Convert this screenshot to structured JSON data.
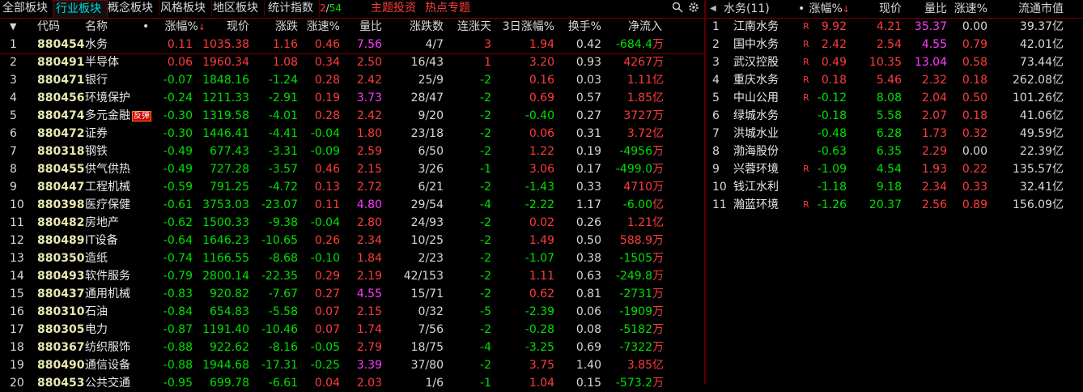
{
  "toolbar": {
    "tabs": [
      "全部板块",
      "行业板块",
      "概念板块",
      "风格板块",
      "地区板块",
      "统计指数"
    ],
    "active_tab": 1,
    "page_current": "2",
    "page_sep": "/",
    "page_total": "54",
    "topic_links": [
      "主题投资",
      "热点专题"
    ],
    "search_icon": "search-icon",
    "settings_icon": "gear-icon"
  },
  "table": {
    "headers": {
      "code": "代码",
      "name": "名称",
      "dot": "•",
      "change_pct": "涨幅%",
      "price": "现价",
      "change": "涨跌",
      "speed": "涨速%",
      "vol_ratio": "量比",
      "updown": "涨跌数",
      "streak": "连涨天",
      "chg3d": "3日涨幅%",
      "turnover": "换手%",
      "netflow": "净流入"
    },
    "sort_arrow": "↓",
    "rows": [
      {
        "idx": "1",
        "code": "880454",
        "name": "水务",
        "chg": "0.11",
        "price": "1035.38",
        "diff": "1.16",
        "speed": "0.46",
        "vr": "7.56",
        "ud": "4/7",
        "streak": "3",
        "chg3d": "1.94",
        "turn": "0.42",
        "flow": "-684.4",
        "unit": "万",
        "cchg": "red",
        "cspeed": "red",
        "cvr": "purple",
        "cstreak": "red",
        "c3d": "red",
        "badge": ""
      },
      {
        "idx": "2",
        "code": "880491",
        "name": "半导体",
        "chg": "0.06",
        "price": "1960.34",
        "diff": "1.08",
        "speed": "0.34",
        "vr": "2.50",
        "ud": "16/43",
        "streak": "1",
        "chg3d": "3.20",
        "turn": "0.93",
        "flow": "4267",
        "unit": "万",
        "cchg": "red",
        "cspeed": "red",
        "cvr": "red",
        "cstreak": "red",
        "c3d": "red",
        "badge": ""
      },
      {
        "idx": "3",
        "code": "880471",
        "name": "银行",
        "chg": "-0.07",
        "price": "1848.16",
        "diff": "-1.24",
        "speed": "0.28",
        "vr": "2.42",
        "ud": "25/9",
        "streak": "-2",
        "chg3d": "0.16",
        "turn": "0.03",
        "flow": "1.11",
        "unit": "亿",
        "cchg": "green",
        "cspeed": "red",
        "cvr": "red",
        "cstreak": "green",
        "c3d": "red",
        "badge": ""
      },
      {
        "idx": "4",
        "code": "880456",
        "name": "环境保护",
        "chg": "-0.24",
        "price": "1211.33",
        "diff": "-2.91",
        "speed": "0.19",
        "vr": "3.73",
        "ud": "28/47",
        "streak": "-2",
        "chg3d": "0.69",
        "turn": "0.57",
        "flow": "1.85",
        "unit": "亿",
        "cchg": "green",
        "cspeed": "red",
        "cvr": "purple",
        "cstreak": "green",
        "c3d": "red",
        "badge": ""
      },
      {
        "idx": "5",
        "code": "880474",
        "name": "多元金融",
        "chg": "-0.30",
        "price": "1319.58",
        "diff": "-4.01",
        "speed": "0.28",
        "vr": "2.42",
        "ud": "9/20",
        "streak": "-2",
        "chg3d": "-0.40",
        "turn": "0.27",
        "flow": "3727",
        "unit": "万",
        "cchg": "green",
        "cspeed": "red",
        "cvr": "red",
        "cstreak": "green",
        "c3d": "green",
        "badge": "反弹"
      },
      {
        "idx": "6",
        "code": "880472",
        "name": "证券",
        "chg": "-0.30",
        "price": "1446.41",
        "diff": "-4.41",
        "speed": "-0.04",
        "vr": "1.80",
        "ud": "23/18",
        "streak": "-2",
        "chg3d": "0.06",
        "turn": "0.31",
        "flow": "3.72",
        "unit": "亿",
        "cchg": "green",
        "cspeed": "green",
        "cvr": "red",
        "cstreak": "green",
        "c3d": "red",
        "badge": ""
      },
      {
        "idx": "7",
        "code": "880318",
        "name": "钢铁",
        "chg": "-0.49",
        "price": "677.43",
        "diff": "-3.31",
        "speed": "-0.09",
        "vr": "2.59",
        "ud": "6/50",
        "streak": "-2",
        "chg3d": "1.22",
        "turn": "0.19",
        "flow": "-4956",
        "unit": "万",
        "cchg": "green",
        "cspeed": "green",
        "cvr": "red",
        "cstreak": "green",
        "c3d": "red",
        "badge": ""
      },
      {
        "idx": "8",
        "code": "880455",
        "name": "供气供热",
        "chg": "-0.49",
        "price": "727.28",
        "diff": "-3.57",
        "speed": "0.46",
        "vr": "2.15",
        "ud": "3/26",
        "streak": "-1",
        "chg3d": "3.06",
        "turn": "0.17",
        "flow": "-499.0",
        "unit": "万",
        "cchg": "green",
        "cspeed": "red",
        "cvr": "red",
        "cstreak": "green",
        "c3d": "red",
        "badge": ""
      },
      {
        "idx": "9",
        "code": "880447",
        "name": "工程机械",
        "chg": "-0.59",
        "price": "791.25",
        "diff": "-4.72",
        "speed": "0.13",
        "vr": "2.72",
        "ud": "6/21",
        "streak": "-2",
        "chg3d": "-1.43",
        "turn": "0.33",
        "flow": "4710",
        "unit": "万",
        "cchg": "green",
        "cspeed": "red",
        "cvr": "red",
        "cstreak": "green",
        "c3d": "green",
        "badge": ""
      },
      {
        "idx": "10",
        "code": "880398",
        "name": "医疗保健",
        "chg": "-0.61",
        "price": "3753.03",
        "diff": "-23.07",
        "speed": "0.11",
        "vr": "4.80",
        "ud": "29/54",
        "streak": "-4",
        "chg3d": "-2.22",
        "turn": "1.17",
        "flow": "-6.00",
        "unit": "亿",
        "cchg": "green",
        "cspeed": "red",
        "cvr": "purple",
        "cstreak": "green",
        "c3d": "green",
        "badge": ""
      },
      {
        "idx": "11",
        "code": "880482",
        "name": "房地产",
        "chg": "-0.62",
        "price": "1500.33",
        "diff": "-9.38",
        "speed": "-0.04",
        "vr": "2.80",
        "ud": "24/93",
        "streak": "-2",
        "chg3d": "0.02",
        "turn": "0.26",
        "flow": "1.21",
        "unit": "亿",
        "cchg": "green",
        "cspeed": "green",
        "cvr": "red",
        "cstreak": "green",
        "c3d": "red",
        "badge": ""
      },
      {
        "idx": "12",
        "code": "880489",
        "name": "IT设备",
        "chg": "-0.64",
        "price": "1646.23",
        "diff": "-10.65",
        "speed": "0.26",
        "vr": "2.34",
        "ud": "10/25",
        "streak": "-2",
        "chg3d": "1.49",
        "turn": "0.50",
        "flow": "588.9",
        "unit": "万",
        "cchg": "green",
        "cspeed": "red",
        "cvr": "red",
        "cstreak": "green",
        "c3d": "red",
        "badge": ""
      },
      {
        "idx": "13",
        "code": "880350",
        "name": "造纸",
        "chg": "-0.74",
        "price": "1166.55",
        "diff": "-8.68",
        "speed": "-0.10",
        "vr": "1.84",
        "ud": "2/23",
        "streak": "-2",
        "chg3d": "-1.07",
        "turn": "0.38",
        "flow": "-1505",
        "unit": "万",
        "cchg": "green",
        "cspeed": "green",
        "cvr": "red",
        "cstreak": "green",
        "c3d": "green",
        "badge": ""
      },
      {
        "idx": "14",
        "code": "880493",
        "name": "软件服务",
        "chg": "-0.79",
        "price": "2800.14",
        "diff": "-22.35",
        "speed": "0.29",
        "vr": "2.19",
        "ud": "42/153",
        "streak": "-2",
        "chg3d": "1.11",
        "turn": "0.63",
        "flow": "-249.8",
        "unit": "万",
        "cchg": "green",
        "cspeed": "red",
        "cvr": "red",
        "cstreak": "green",
        "c3d": "red",
        "badge": ""
      },
      {
        "idx": "15",
        "code": "880437",
        "name": "通用机械",
        "chg": "-0.83",
        "price": "920.82",
        "diff": "-7.67",
        "speed": "0.27",
        "vr": "4.55",
        "ud": "15/71",
        "streak": "-2",
        "chg3d": "0.62",
        "turn": "0.81",
        "flow": "-2731",
        "unit": "万",
        "cchg": "green",
        "cspeed": "red",
        "cvr": "purple",
        "cstreak": "green",
        "c3d": "red",
        "badge": ""
      },
      {
        "idx": "16",
        "code": "880310",
        "name": "石油",
        "chg": "-0.84",
        "price": "654.83",
        "diff": "-5.58",
        "speed": "0.07",
        "vr": "2.15",
        "ud": "0/32",
        "streak": "-5",
        "chg3d": "-2.39",
        "turn": "0.06",
        "flow": "-1909",
        "unit": "万",
        "cchg": "green",
        "cspeed": "red",
        "cvr": "red",
        "cstreak": "green",
        "c3d": "green",
        "badge": ""
      },
      {
        "idx": "17",
        "code": "880305",
        "name": "电力",
        "chg": "-0.87",
        "price": "1191.40",
        "diff": "-10.46",
        "speed": "0.07",
        "vr": "1.74",
        "ud": "7/56",
        "streak": "-2",
        "chg3d": "-0.28",
        "turn": "0.08",
        "flow": "-5182",
        "unit": "万",
        "cchg": "green",
        "cspeed": "red",
        "cvr": "red",
        "cstreak": "green",
        "c3d": "green",
        "badge": ""
      },
      {
        "idx": "18",
        "code": "880367",
        "name": "纺织服饰",
        "chg": "-0.88",
        "price": "922.62",
        "diff": "-8.16",
        "speed": "-0.05",
        "vr": "2.79",
        "ud": "18/75",
        "streak": "-4",
        "chg3d": "-3.25",
        "turn": "0.69",
        "flow": "-7322",
        "unit": "万",
        "cchg": "green",
        "cspeed": "green",
        "cvr": "red",
        "cstreak": "green",
        "c3d": "green",
        "badge": ""
      },
      {
        "idx": "19",
        "code": "880490",
        "name": "通信设备",
        "chg": "-0.88",
        "price": "1944.68",
        "diff": "-17.31",
        "speed": "-0.25",
        "vr": "3.39",
        "ud": "37/80",
        "streak": "-2",
        "chg3d": "3.75",
        "turn": "1.40",
        "flow": "3.85",
        "unit": "亿",
        "cchg": "green",
        "cspeed": "green",
        "cvr": "purple",
        "cstreak": "green",
        "c3d": "red",
        "badge": ""
      },
      {
        "idx": "20",
        "code": "880453",
        "name": "公共交通",
        "chg": "-0.95",
        "price": "699.78",
        "diff": "-6.61",
        "speed": "0.04",
        "vr": "2.03",
        "ud": "1/6",
        "streak": "-1",
        "chg3d": "1.04",
        "turn": "0.15",
        "flow": "-573.2",
        "unit": "万",
        "cchg": "green",
        "cspeed": "red",
        "cvr": "red",
        "cstreak": "green",
        "c3d": "red",
        "badge": ""
      }
    ]
  },
  "right_panel": {
    "title": "水务(11)",
    "dot": "•",
    "headers": {
      "chg": "涨幅%",
      "price": "现价",
      "vr": "量比",
      "speed": "涨速%",
      "mcap": "流通市值"
    },
    "sort_arrow": "↓",
    "panel_icon": "panel-toggle-icon",
    "rows": [
      {
        "idx": "1",
        "name": "江南水务",
        "flag": "R",
        "chg": "9.92",
        "price": "4.21",
        "vr": "35.37",
        "speed": "0.00",
        "mcap": "39.37",
        "unit": "亿",
        "cchg": "red",
        "cvr": "purple",
        "cspeed": "white"
      },
      {
        "idx": "2",
        "name": "国中水务",
        "flag": "R",
        "chg": "2.42",
        "price": "2.54",
        "vr": "4.55",
        "speed": "0.79",
        "mcap": "42.01",
        "unit": "亿",
        "cchg": "red",
        "cvr": "purple",
        "cspeed": "red"
      },
      {
        "idx": "3",
        "name": "武汉控股",
        "flag": "R",
        "chg": "0.49",
        "price": "10.35",
        "vr": "13.04",
        "speed": "0.58",
        "mcap": "73.44",
        "unit": "亿",
        "cchg": "red",
        "cvr": "purple",
        "cspeed": "red"
      },
      {
        "idx": "4",
        "name": "重庆水务",
        "flag": "R",
        "chg": "0.18",
        "price": "5.46",
        "vr": "2.32",
        "speed": "0.18",
        "mcap": "262.08",
        "unit": "亿",
        "cchg": "red",
        "cvr": "red",
        "cspeed": "red"
      },
      {
        "idx": "5",
        "name": "中山公用",
        "flag": "R",
        "chg": "-0.12",
        "price": "8.08",
        "vr": "2.04",
        "speed": "0.50",
        "mcap": "101.26",
        "unit": "亿",
        "cchg": "green",
        "cvr": "red",
        "cspeed": "red"
      },
      {
        "idx": "6",
        "name": "绿城水务",
        "flag": "",
        "chg": "-0.18",
        "price": "5.58",
        "vr": "2.07",
        "speed": "0.18",
        "mcap": "41.06",
        "unit": "亿",
        "cchg": "green",
        "cvr": "red",
        "cspeed": "red"
      },
      {
        "idx": "7",
        "name": "洪城水业",
        "flag": "",
        "chg": "-0.48",
        "price": "6.28",
        "vr": "1.73",
        "speed": "0.32",
        "mcap": "49.59",
        "unit": "亿",
        "cchg": "green",
        "cvr": "red",
        "cspeed": "red"
      },
      {
        "idx": "8",
        "name": "渤海股份",
        "flag": "",
        "chg": "-0.63",
        "price": "6.35",
        "vr": "2.29",
        "speed": "0.00",
        "mcap": "22.39",
        "unit": "亿",
        "cchg": "green",
        "cvr": "red",
        "cspeed": "white"
      },
      {
        "idx": "9",
        "name": "兴蓉环境",
        "flag": "R",
        "chg": "-1.09",
        "price": "4.54",
        "vr": "1.93",
        "speed": "0.22",
        "mcap": "135.57",
        "unit": "亿",
        "cchg": "green",
        "cvr": "red",
        "cspeed": "red"
      },
      {
        "idx": "10",
        "name": "钱江水利",
        "flag": "",
        "chg": "-1.18",
        "price": "9.18",
        "vr": "2.34",
        "speed": "0.33",
        "mcap": "32.41",
        "unit": "亿",
        "cchg": "green",
        "cvr": "red",
        "cspeed": "red"
      },
      {
        "idx": "11",
        "name": "瀚蓝环境",
        "flag": "R",
        "chg": "-1.26",
        "price": "20.37",
        "vr": "2.56",
        "speed": "0.89",
        "mcap": "156.09",
        "unit": "亿",
        "cchg": "green",
        "cvr": "red",
        "cspeed": "red"
      }
    ]
  }
}
